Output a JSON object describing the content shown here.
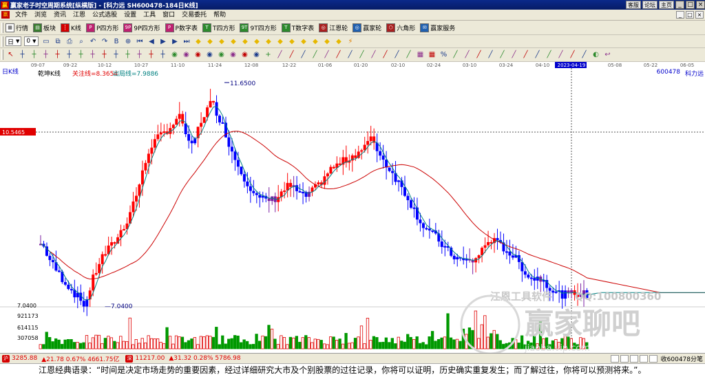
{
  "window": {
    "title": "赢家老子时空周期系统[纵横版] - [科力远  SH600478-184日K线]",
    "links": [
      "客服",
      "论坛",
      "主页"
    ],
    "controls": [
      "_",
      "□",
      "×"
    ]
  },
  "menu": {
    "items": [
      "文件",
      "浏览",
      "资讯",
      "江恩",
      "公式选股",
      "设置",
      "工具",
      "窗口",
      "交易委托",
      "帮助"
    ],
    "mdi_controls": [
      "_",
      "□",
      "×"
    ]
  },
  "toolbar1": {
    "items": [
      {
        "label": "行情",
        "icon": "grid-icon",
        "color": "#ffffff"
      },
      {
        "label": "板块",
        "icon": "block-icon",
        "color": "#3a7d2f"
      },
      {
        "label": "K线",
        "icon": "kline-icon",
        "color": "#d40000"
      },
      {
        "label": "P四方形",
        "icon": "P",
        "color": "#c02070"
      },
      {
        "label": "9P四方形",
        "icon": "9P",
        "color": "#c02070"
      },
      {
        "label": "P数字表",
        "icon": "P",
        "color": "#c02070"
      },
      {
        "label": "T四方形",
        "icon": "T",
        "color": "#2c8a2c"
      },
      {
        "label": "9T四方形",
        "icon": "9T",
        "color": "#2c8a2c"
      },
      {
        "label": "T数字表",
        "icon": "T",
        "color": "#2c8a2c"
      },
      {
        "label": "江恩轮",
        "icon": "wheel-icon",
        "color": "#aa2020"
      },
      {
        "label": "赢家轮",
        "icon": "wheel-icon",
        "color": "#2060b0"
      },
      {
        "label": "六角形",
        "icon": "hexagon-icon",
        "color": "#aa2020"
      },
      {
        "label": "赢家服务",
        "icon": "service-icon",
        "color": "#2060b0"
      }
    ]
  },
  "toolbar2": {
    "dropdowns": [
      "日",
      "0"
    ],
    "icons": [
      "doc-icon",
      "copy-icon",
      "print-icon",
      "find-icon",
      "undo-icon",
      "redo-icon",
      "bold-icon",
      "zoom-icon",
      "first-icon",
      "prev-icon",
      "play-icon",
      "next-icon",
      "last-icon",
      "diamond-icon",
      "diamond-icon",
      "diamond-icon",
      "diamond-icon",
      "diamond-icon",
      "diamond-icon",
      "diamond-icon",
      "diamond-icon",
      "diamond-icon",
      "diamond-icon",
      "diamond-icon",
      "diamond-icon",
      "diamond-icon",
      "bolt-icon"
    ]
  },
  "toolbar3": {
    "icons": [
      "pointer-icon",
      "kline-tool-icon",
      "kline-tool-icon",
      "kline-tool-icon",
      "kline-tool-icon",
      "kline-tool-icon",
      "kline-tool-icon",
      "kline-tool-icon",
      "kline-tool-icon",
      "kline-tool-icon",
      "kline-tool-icon",
      "kline-tool-icon",
      "kline-tool-icon",
      "kline-tool-icon",
      "circle-tool-icon",
      "circle-tool-icon",
      "circle-tool-icon",
      "circle-tool-icon",
      "circle-tool-icon",
      "circle-tool-icon",
      "circle-tool-icon",
      "circle-tool-icon",
      "cross-icon",
      "line-tool-icon",
      "line-tool-icon",
      "line-tool-icon",
      "line-tool-icon",
      "line-tool-icon",
      "line-tool-icon",
      "line-tool-icon",
      "line-tool-icon",
      "line-tool-icon",
      "line-tool-icon",
      "line-tool-icon",
      "line-tool-icon",
      "table-icon",
      "table-icon",
      "percent-icon",
      "line-tool-icon",
      "line-tool-icon",
      "line-tool-icon",
      "line-tool-icon",
      "line-tool-icon",
      "line-tool-icon",
      "line-tool-icon",
      "line-tool-icon",
      "line-tool-icon",
      "line-tool-icon",
      "line-tool-icon",
      "line-tool-icon",
      "palette-icon",
      "back-icon"
    ]
  },
  "chart_header": {
    "period_label": "日K线",
    "indicator_name": "乾坤K线",
    "attention_line": "关注线=8.3654",
    "exit_line": "出局线=7.9886",
    "stock_code": "600478",
    "stock_name": "科力远",
    "crosshair_price": "10.5465",
    "crosshair_date": "2023-04-19",
    "high_label": "11.6500",
    "low_label": "7.0400",
    "axis_low": "7.0400"
  },
  "chart_data": {
    "type": "candlestick",
    "date_ticks": [
      "09-07",
      "09-22",
      "10-12",
      "10-27",
      "11-10",
      "11-24",
      "12-08",
      "12-22",
      "01-06",
      "01-20",
      "02-10",
      "02-24",
      "03-10",
      "03-24",
      "04-10",
      "2023-04-19",
      "05-08",
      "05-22",
      "06-05"
    ],
    "volume_ticks": [
      "921173",
      "614115",
      "307058"
    ],
    "colors": {
      "up": "#ff0000",
      "down": "#0000ff",
      "turn": "#7b1fa2",
      "ma_fast": "#008080",
      "ma_slow": "#cc0000",
      "volume_up": "#e00000",
      "volume_down": "#009900"
    },
    "price_range": [
      7.04,
      11.65
    ],
    "watermark": {
      "brand": "江恩工具软件",
      "qq": "QQ:100800360",
      "site": "赢家聊吧",
      "url": "jiaoba.vip.com"
    }
  },
  "status": {
    "index1_value": "3285.88",
    "index1_change": "▲21.78 0.67% 4661.75亿",
    "index2_value": "11217.00",
    "index2_change": "▲31.32 0.28% 5786.98",
    "receive": "收600478分笔"
  },
  "quote": {
    "text": "江恩经典语录：“时间是决定市场走势的重要因素，经过详细研究大市及个别股票的过往记录，你将可以证明，历史确实重复发生；而了解过往，你将可以预测将来。”。"
  }
}
